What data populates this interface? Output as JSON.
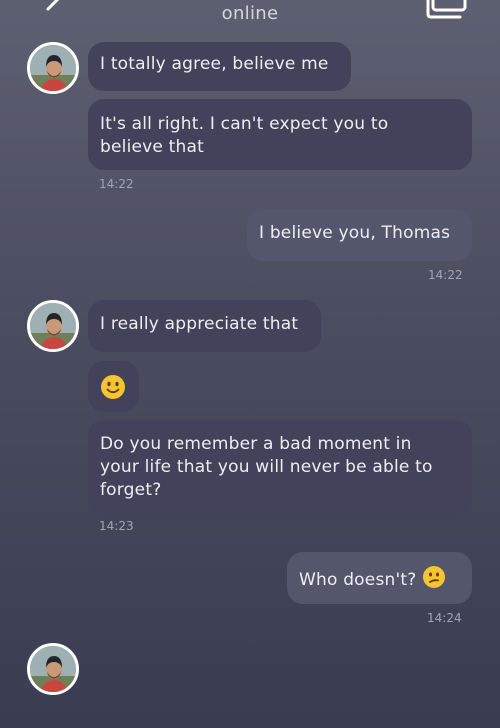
{
  "header": {
    "status": "online",
    "back_icon": "chevron-left-icon",
    "gallery_icon": "photo-stack-icon"
  },
  "messages": [
    {
      "text": "I totally agree, believe me"
    },
    {
      "text_line1": "It's all right. I can't expect you to",
      "text_line2": "believe that",
      "time": "14:22"
    },
    {
      "text": "I believe you, Thomas",
      "time": "14:22"
    },
    {
      "text": "I really appreciate that"
    },
    {
      "emoji": "slightly-smiling-face-icon"
    },
    {
      "text_line1": "Do you remember a bad moment in",
      "text_line2": "your life that you will never be able to",
      "text_line3": "forget?",
      "time": "14:23"
    },
    {
      "text": "Who doesn't?",
      "emoji": "confused-face-icon",
      "time": "14:24"
    }
  ],
  "colors": {
    "bubble_incoming": "#42435a",
    "bubble_outgoing": "#54566c",
    "emoji_yellow": "#f6c430"
  }
}
